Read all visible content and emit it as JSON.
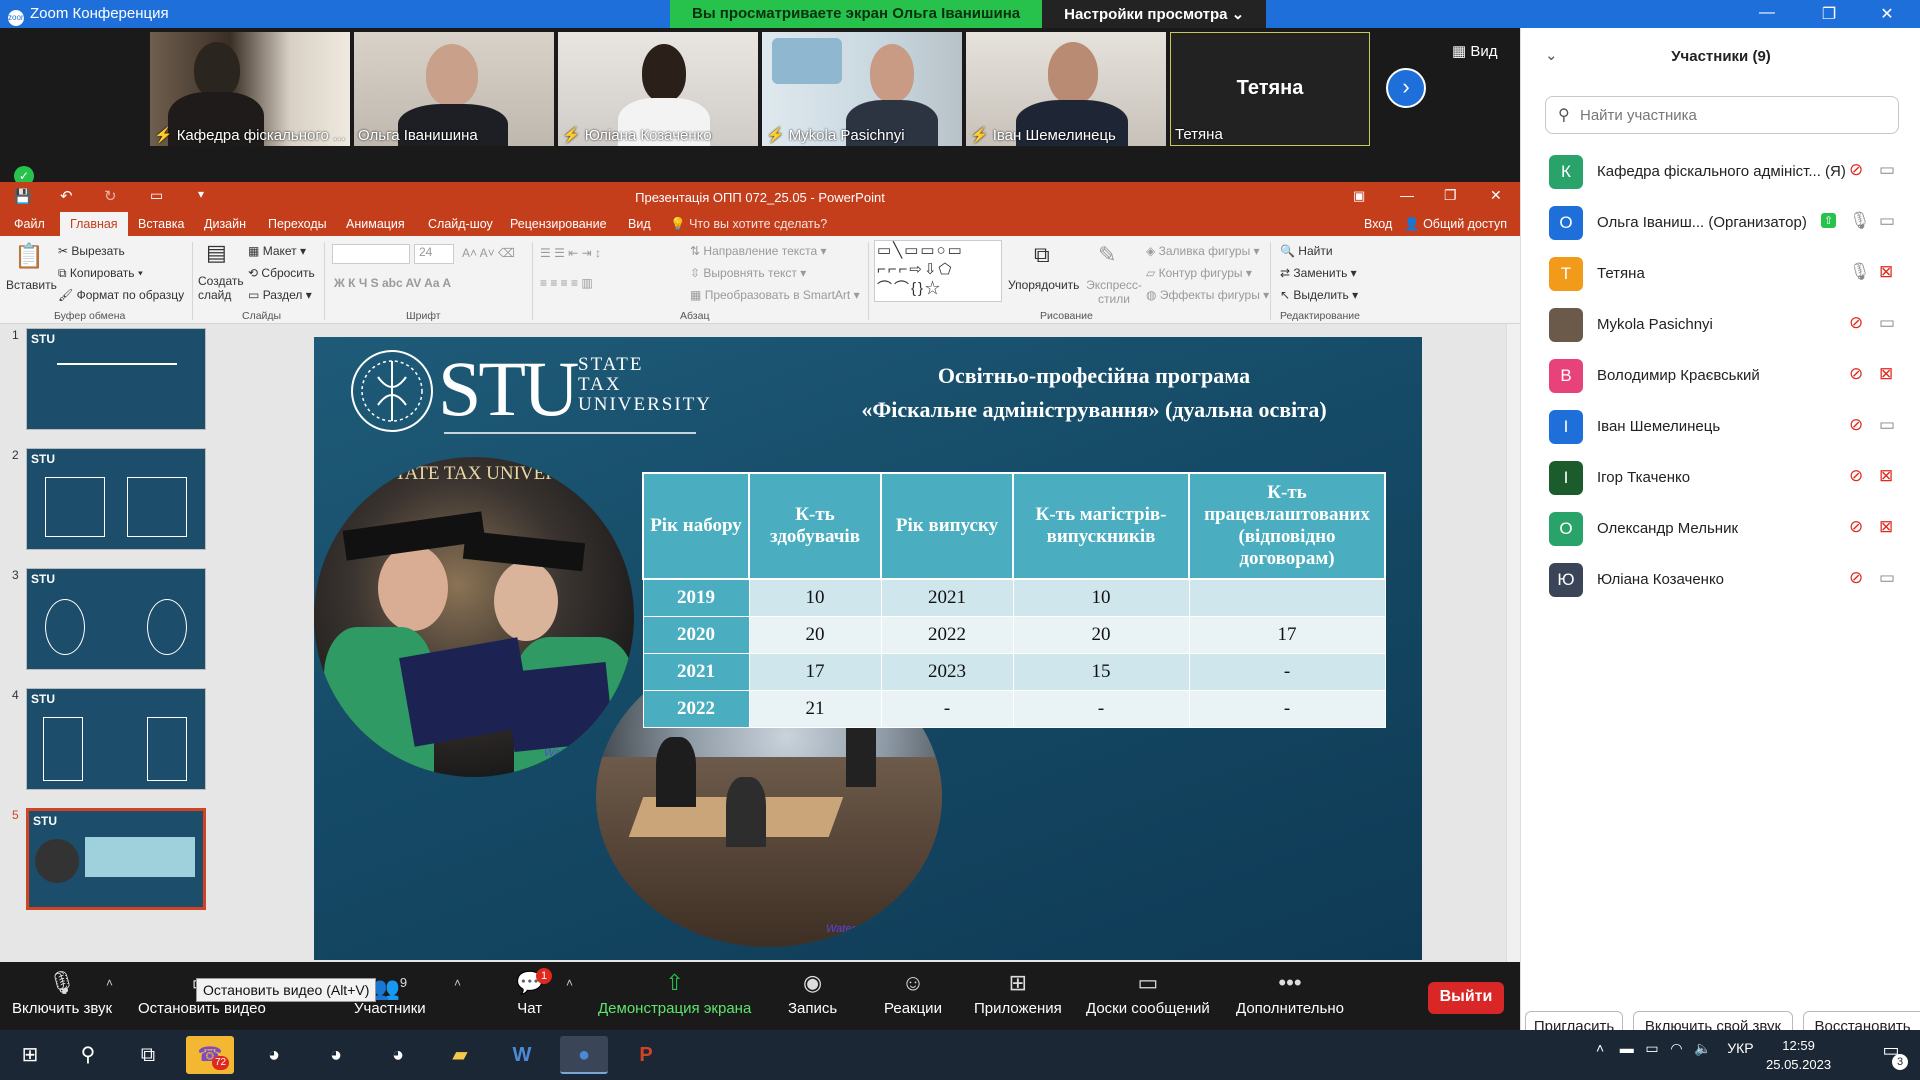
{
  "zoom": {
    "window_title": "Zoom Конференция",
    "share_banner": "Вы просматриваете экран Ольга Іванишина",
    "view_settings": "Настройки просмотра",
    "view_button": "Вид"
  },
  "video_tiles": [
    {
      "name": "Кафедра фіскального ...",
      "muted": true
    },
    {
      "name": "Ольга Іванишина",
      "muted": false
    },
    {
      "name": "Юліана Козаченко",
      "muted": true
    },
    {
      "name": "Mykola Pasichnyi",
      "muted": true
    },
    {
      "name": "Іван Шемелинець",
      "muted": true
    },
    {
      "name": "Тетяна",
      "center_name": "Тетяна",
      "muted": false
    }
  ],
  "ppt": {
    "window_title": "Презентація ОПП 072_25.05 - PowerPoint",
    "tabs": [
      "Файл",
      "Главная",
      "Вставка",
      "Дизайн",
      "Переходы",
      "Анимация",
      "Слайд-шоу",
      "Рецензирование",
      "Вид"
    ],
    "tell_me": "Что вы хотите сделать?",
    "sign_in": "Вход",
    "share": "Общий доступ",
    "ribbon": {
      "paste": "Вставить",
      "cut": "Вырезать",
      "copy": "Копировать",
      "format_painter": "Формат по образцу",
      "clipboard_group": "Буфер обмена",
      "new_slide": "Создать слайд",
      "layout": "Макет",
      "reset": "Сбросить",
      "section": "Раздел",
      "slides_group": "Слайды",
      "font_size": "24",
      "font_group": "Шрифт",
      "text_direction": "Направление текста",
      "align_text": "Выровнять текст",
      "smartart": "Преобразовать в SmartArt",
      "paragraph_group": "Абзац",
      "arrange": "Упорядочить",
      "quick_styles": "Экспресс-стили",
      "shape_fill": "Заливка фигуры",
      "shape_outline": "Контур фигуры",
      "shape_effects": "Эффекты фигуры",
      "drawing_group": "Рисование",
      "find": "Найти",
      "replace": "Заменить",
      "select": "Выделить",
      "editing_group": "Редактирование"
    },
    "thumbnails": [
      "1",
      "2",
      "3",
      "4",
      "5"
    ],
    "selected_thumbnail": 5
  },
  "slide": {
    "logo_letters": "STU",
    "logo_line1": "STATE",
    "logo_line2": "TAX",
    "logo_line3": "UNIVERSITY",
    "title_line1": "Освітньо-професійна програма",
    "title_line2": "«Фіскальне адміністрування» (дуальна освіта)",
    "photo_caption": "STATE TAX UNIVERSITY",
    "watermark": "Watermarkly",
    "table": {
      "headers": [
        "Рік набору",
        "К-ть здобувачів",
        "Рік випуску",
        "К-ть магістрів-випускників",
        "К-ть працевлаштованих (відповідно договорам)"
      ],
      "rows": [
        [
          "2019",
          "10",
          "2021",
          "10",
          ""
        ],
        [
          "2020",
          "20",
          "2022",
          "20",
          "17"
        ],
        [
          "2021",
          "17",
          "2023",
          "15",
          "-"
        ],
        [
          "2022",
          "21",
          "-",
          "-",
          "-"
        ]
      ]
    }
  },
  "participants": {
    "title": "Участники (9)",
    "search_placeholder": "Найти участника",
    "list": [
      {
        "initial": "К",
        "color": "#2aa36b",
        "name": "Кафедра фіскального адмініст... (Я)",
        "mic": "muted",
        "cam": "on"
      },
      {
        "initial": "О",
        "color": "#1e6fd9",
        "name": "Ольга Іваниш... (Организатор)",
        "mic": "on",
        "cam": "on"
      },
      {
        "initial": "Т",
        "color": "#f29a1a",
        "name": "Тетяна",
        "mic": "on",
        "cam": "off"
      },
      {
        "initial": "",
        "color": "#6b5a4a",
        "name": "Mykola Pasichnyi",
        "mic": "muted",
        "cam": "on"
      },
      {
        "initial": "В",
        "color": "#e8427a",
        "name": "Володимир Краєвський",
        "mic": "muted",
        "cam": "off"
      },
      {
        "initial": "І",
        "color": "#1e6fd9",
        "name": "Іван Шемелинець",
        "mic": "muted",
        "cam": "on"
      },
      {
        "initial": "І",
        "color": "#1c5c2c",
        "name": "Ігор Ткаченко",
        "mic": "muted",
        "cam": "off"
      },
      {
        "initial": "О",
        "color": "#2aa36b",
        "name": "Олександр Мельник",
        "mic": "muted",
        "cam": "off"
      },
      {
        "initial": "Ю",
        "color": "#3a4658",
        "name": "Юліана Козаченко",
        "mic": "muted",
        "cam": "on"
      }
    ],
    "invite": "Пригласить",
    "unmute_me": "Включить свой звук",
    "restore": "Восстановить"
  },
  "toolbar": {
    "unmute": "Включить звук",
    "stop_video": "Остановить видео",
    "tooltip": "Остановить видео (Alt+V)",
    "participants_count": "9",
    "participants": "Участники",
    "chat": "Чат",
    "chat_badge": "1",
    "share_screen": "Демонстрация экрана",
    "record": "Запись",
    "reactions": "Реакции",
    "apps": "Приложения",
    "whiteboards": "Доски сообщений",
    "more": "Дополнительно",
    "leave": "Выйти"
  },
  "taskbar": {
    "viber_badge": "72",
    "language": "УКР",
    "time": "12:59",
    "date": "25.05.2023",
    "notifications": "3"
  }
}
